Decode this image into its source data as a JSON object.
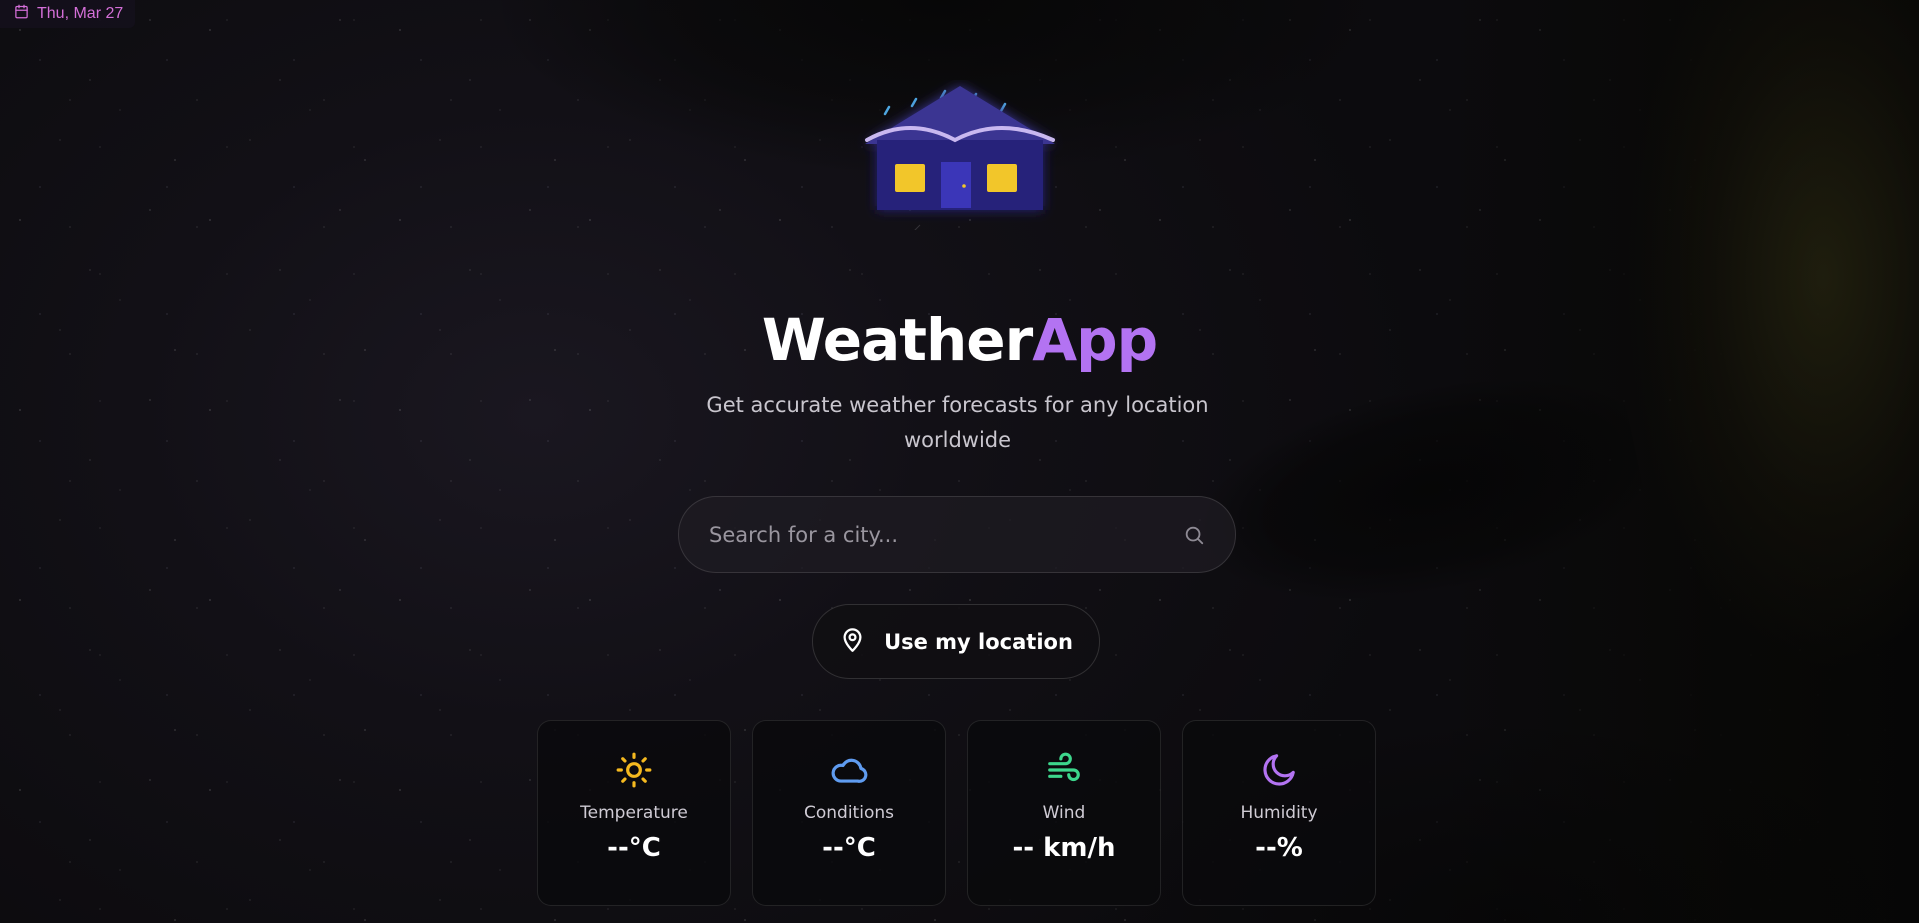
{
  "date_chip": {
    "text": "Thu, Mar 27",
    "icon": "calendar-icon",
    "color": "#d46fd8"
  },
  "hero": {
    "title_part1": "Weather",
    "title_part2": "App",
    "accent_color": "#b373f2",
    "subtitle": "Get accurate weather forecasts for any location worldwide",
    "logo_icon": "house-rain-icon"
  },
  "search": {
    "placeholder": "Search for a city...",
    "value": "",
    "icon": "search-icon"
  },
  "location_button": {
    "label": "Use my location",
    "icon": "map-pin-icon"
  },
  "stats": [
    {
      "icon": "sun-icon",
      "label": "Temperature",
      "value": "--°C",
      "color": "#f5b91f"
    },
    {
      "icon": "cloud-icon",
      "label": "Conditions",
      "value": "--°C",
      "color": "#5f9cf0"
    },
    {
      "icon": "wind-icon",
      "label": "Wind",
      "value": "-- km/h",
      "color": "#3dd68c"
    },
    {
      "icon": "moon-icon",
      "label": "Humidity",
      "value": "--%",
      "color": "#b373f2"
    }
  ]
}
